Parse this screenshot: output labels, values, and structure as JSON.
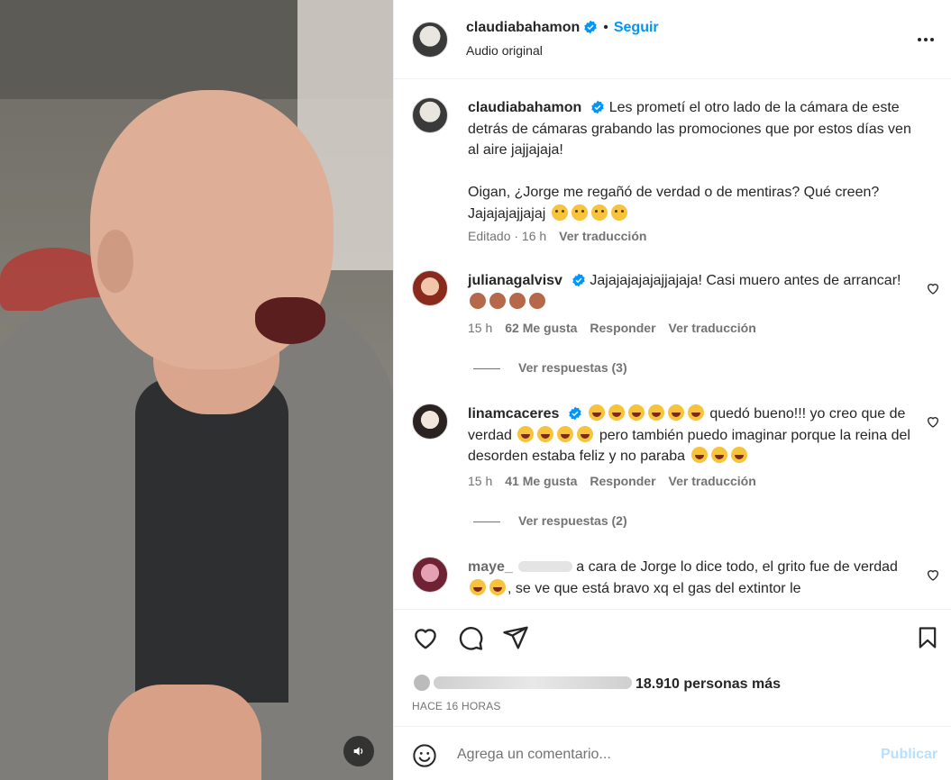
{
  "post": {
    "author": "claudiabahamon",
    "follow_label": "Seguir",
    "separator": "•",
    "audio_label": "Audio original",
    "caption_line1": "Les prometí el otro lado de la cámara de este detrás de cámaras grabando las promociones que por estos días ven al aire jajjajaja!",
    "caption_line2": "Oigan, ¿Jorge me regañó de verdad o de mentiras? Qué creen? Jajajajajjajaj",
    "caption_meta_edited": "Editado · 16 h",
    "caption_translate": "Ver traducción"
  },
  "comments": [
    {
      "username": "julianagalvisv",
      "text": "Jajajajajajajjajaja! Casi muero antes de arrancar!",
      "time": "15 h",
      "likes": "62 Me gusta",
      "reply": "Responder",
      "translate": "Ver traducción",
      "view_replies": "Ver respuestas (3)"
    },
    {
      "username": "linamcaceres",
      "text_a": "quedó bueno!!! yo creo que de verdad",
      "text_b": "pero también puedo imaginar porque la reina del desorden estaba feliz y no paraba",
      "time": "15 h",
      "likes": "41 Me gusta",
      "reply": "Responder",
      "translate": "Ver traducción",
      "view_replies": "Ver respuestas (2)"
    },
    {
      "username": "maye_",
      "text_a": "a cara de Jorge lo dice todo, el grito fue de verdad",
      "text_b": ", se ve que está bravo xq el gas del extintor le"
    }
  ],
  "likes": {
    "count_text": "18.910 personas más"
  },
  "timestamp": "HACE 16 HORAS",
  "add_comment": {
    "placeholder": "Agrega un comentario...",
    "publish_label": "Publicar"
  },
  "colors": {
    "link_blue": "#0095f6",
    "verified_blue": "#0095f6",
    "muted": "#737373",
    "publish_disabled": "#b8dffd"
  }
}
